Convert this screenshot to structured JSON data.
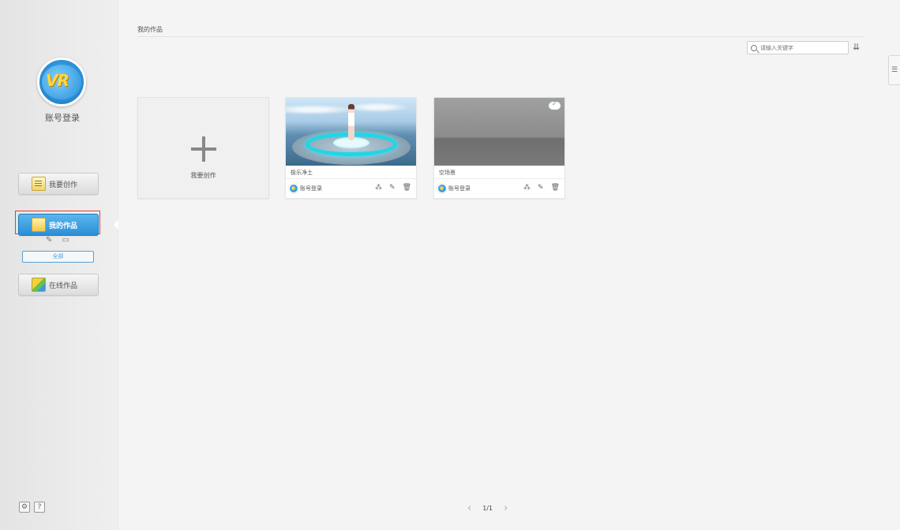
{
  "sidebar": {
    "account_label": "账号登录",
    "buttons": {
      "create": "我要创作",
      "mine": "我的作品",
      "online": "在线作品"
    },
    "all_filter": "全部",
    "icons": [
      "pencil-icon",
      "folder-icon",
      "settings-icon",
      "help-icon"
    ],
    "help_glyph": "?"
  },
  "main": {
    "page_title": "我的作品",
    "search": {
      "placeholder": "请输入关键字"
    },
    "new_card_label": "我要创作",
    "works": [
      {
        "title": "极乐净土",
        "author": "账号登录",
        "cloud_synced": false
      },
      {
        "title": "空场景",
        "author": "账号登录",
        "cloud_synced": true
      }
    ],
    "pagination": {
      "page": "1/1"
    }
  },
  "colors": {
    "accent_blue": "#2a8fd6",
    "highlight_red": "#e03a3a",
    "ring_cyan": "#1fd6e8"
  }
}
